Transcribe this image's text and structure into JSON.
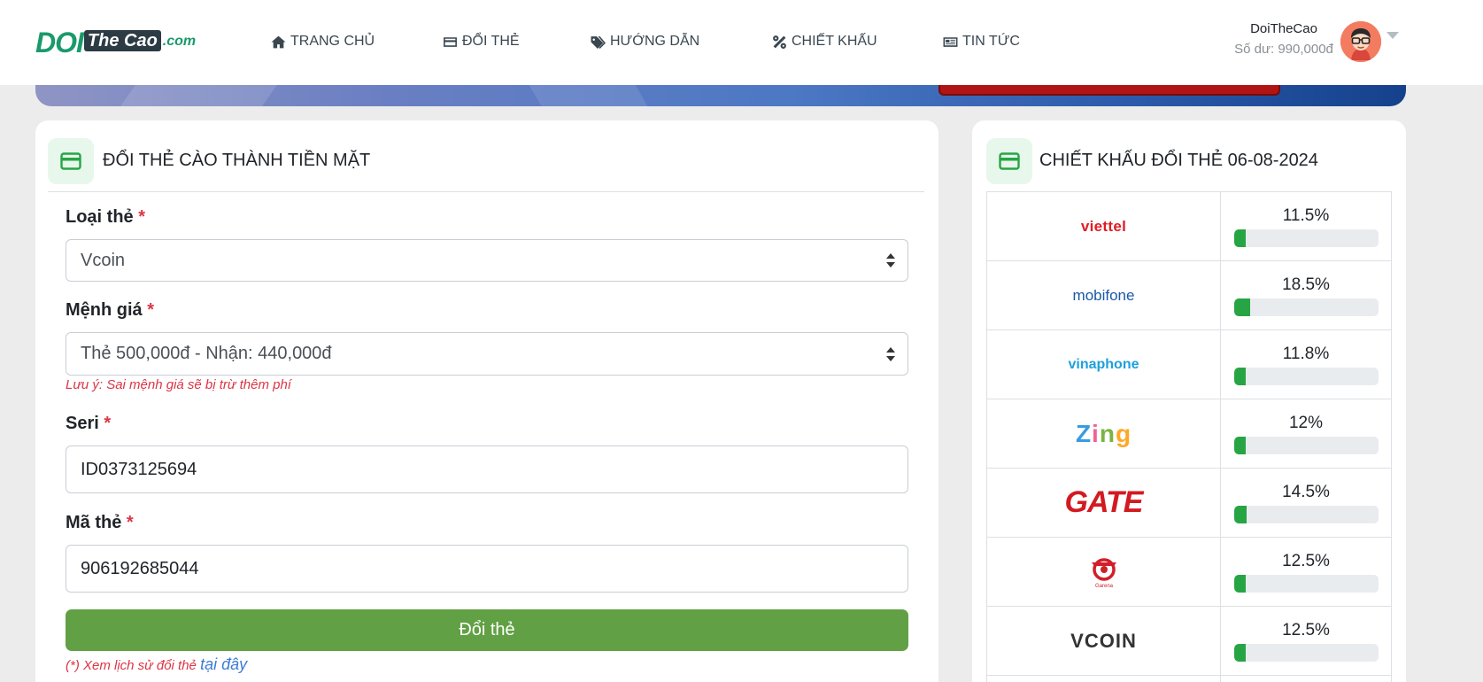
{
  "brand": {
    "doi": "DOI",
    "thecao": "The Cao",
    "com": ".com"
  },
  "nav": [
    {
      "label": "TRANG CHỦ",
      "icon": "home-icon"
    },
    {
      "label": "ĐỔI THẺ",
      "icon": "credit-card-icon"
    },
    {
      "label": "HƯỚNG DẪN",
      "icon": "tags-icon"
    },
    {
      "label": "CHIẾT KHẤU",
      "icon": "percent-icon"
    },
    {
      "label": "TIN TỨC",
      "icon": "newspaper-icon"
    }
  ],
  "user": {
    "name": "DoiTheCao",
    "balance": "Số dư: 990,000đ"
  },
  "form": {
    "title": "ĐỔI THẺ CÀO THÀNH TIỀN MẶT",
    "required_mark": "*",
    "card_type_label": "Loại thẻ",
    "card_type_value": "Vcoin",
    "value_label": "Mệnh giá",
    "value_value": "Thẻ 500,000đ - Nhận: 440,000đ",
    "value_note": "Lưu ý: Sai mệnh giá sẽ bị trừ thêm phí",
    "serial_label": "Seri",
    "serial_value": "ID0373125694",
    "pin_label": "Mã thẻ",
    "pin_value": "906192685044",
    "submit_label": "Đổi thẻ",
    "history_note": "(*) Xem lịch sử đổi thẻ",
    "history_link": "tại đây"
  },
  "rates": {
    "title": "CHIẾT KHẤU ĐỔI THẺ 06-08-2024",
    "items": [
      {
        "operator": "viettel",
        "logo_text": "viettel",
        "percent_label": "11.5%",
        "percent": 11.5
      },
      {
        "operator": "mobifone",
        "logo_text": "mobifone",
        "percent_label": "18.5%",
        "percent": 18.5
      },
      {
        "operator": "vinaphone",
        "logo_text": "vinaphone",
        "percent_label": "11.8%",
        "percent": 11.8
      },
      {
        "operator": "zing",
        "logo_text": "Zing",
        "percent_label": "12%",
        "percent": 12
      },
      {
        "operator": "gate",
        "logo_text": "GATE",
        "percent_label": "14.5%",
        "percent": 14.5
      },
      {
        "operator": "garena",
        "logo_text": "Garena",
        "percent_label": "12.5%",
        "percent": 12.5
      },
      {
        "operator": "vcoin",
        "logo_text": "VCOIN",
        "percent_label": "12.5%",
        "percent": 12.5
      }
    ]
  },
  "colors": {
    "primary_green": "#61a044",
    "bar_green": "#27a544",
    "required_red": "#dc3545",
    "brand_teal": "#1a9a6c"
  }
}
